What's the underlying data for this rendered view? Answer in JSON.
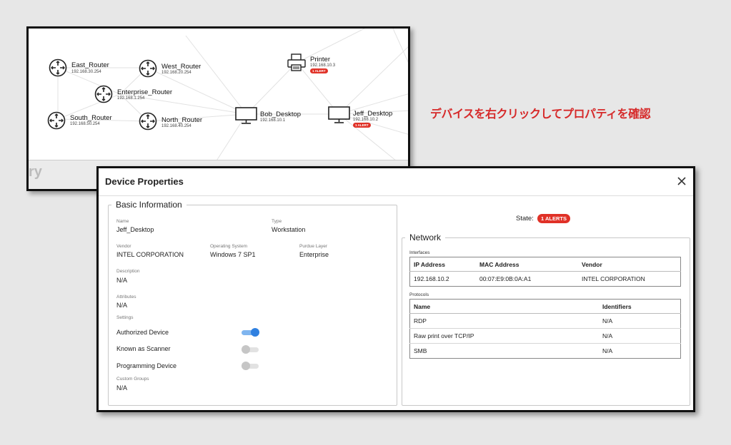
{
  "network_map": {
    "nodes": [
      {
        "name": "East_Router",
        "ip": "192.168.30.254"
      },
      {
        "name": "West_Router",
        "ip": "192.168.20.254"
      },
      {
        "name": "Enterprise_Router",
        "ip": "192.168.1.254"
      },
      {
        "name": "South_Router",
        "ip": "192.168.50.254"
      },
      {
        "name": "North_Router",
        "ip": "192.168.40.254"
      },
      {
        "name": "Printer",
        "ip": "192.168.10.3",
        "alert": "1 ALERT"
      },
      {
        "name": "Bob_Desktop",
        "ip": "192.168.10.1"
      },
      {
        "name": "Jeff_Desktop",
        "ip": "192.168.10.2",
        "alert": "1 ALERT"
      }
    ],
    "footer_text": "ry"
  },
  "annotation": "デバイスを右クリックしてプロパティを確認",
  "dialog": {
    "title": "Device Properties",
    "basic": {
      "legend": "Basic Information",
      "name_label": "Name",
      "name_value": "Jeff_Desktop",
      "type_label": "Type",
      "type_value": "Workstation",
      "vendor_label": "Vendor",
      "vendor_value": "INTEL CORPORATION",
      "os_label": "Operating System",
      "os_value": "Windows 7 SP1",
      "purdue_label": "Purdue Layer",
      "purdue_value": "Enterprise",
      "description_label": "Description",
      "description_value": "N/A",
      "attributes_label": "Attributes",
      "attributes_value": "N/A",
      "settings_label": "Settings",
      "settings": [
        {
          "label": "Authorized Device",
          "on": true
        },
        {
          "label": "Known as Scanner",
          "on": false
        },
        {
          "label": "Programming Device",
          "on": false
        }
      ],
      "custom_groups_label": "Custom Groups",
      "custom_groups_value": "N/A"
    },
    "state_label": "State:",
    "state_badge": "1 ALERTS",
    "network": {
      "legend": "Network",
      "interfaces_label": "Interfaces",
      "interfaces_headers": [
        "IP Address",
        "MAC Address",
        "Vendor"
      ],
      "interfaces_rows": [
        [
          "192.168.10.2",
          "00:07:E9:0B:0A:A1",
          "INTEL CORPORATION"
        ]
      ],
      "protocols_label": "Protocols",
      "protocols_headers": [
        "Name",
        "Identifiers"
      ],
      "protocols_rows": [
        [
          "RDP",
          "N/A"
        ],
        [
          "Raw print over TCP/IP",
          "N/A"
        ],
        [
          "SMB",
          "N/A"
        ]
      ]
    }
  }
}
